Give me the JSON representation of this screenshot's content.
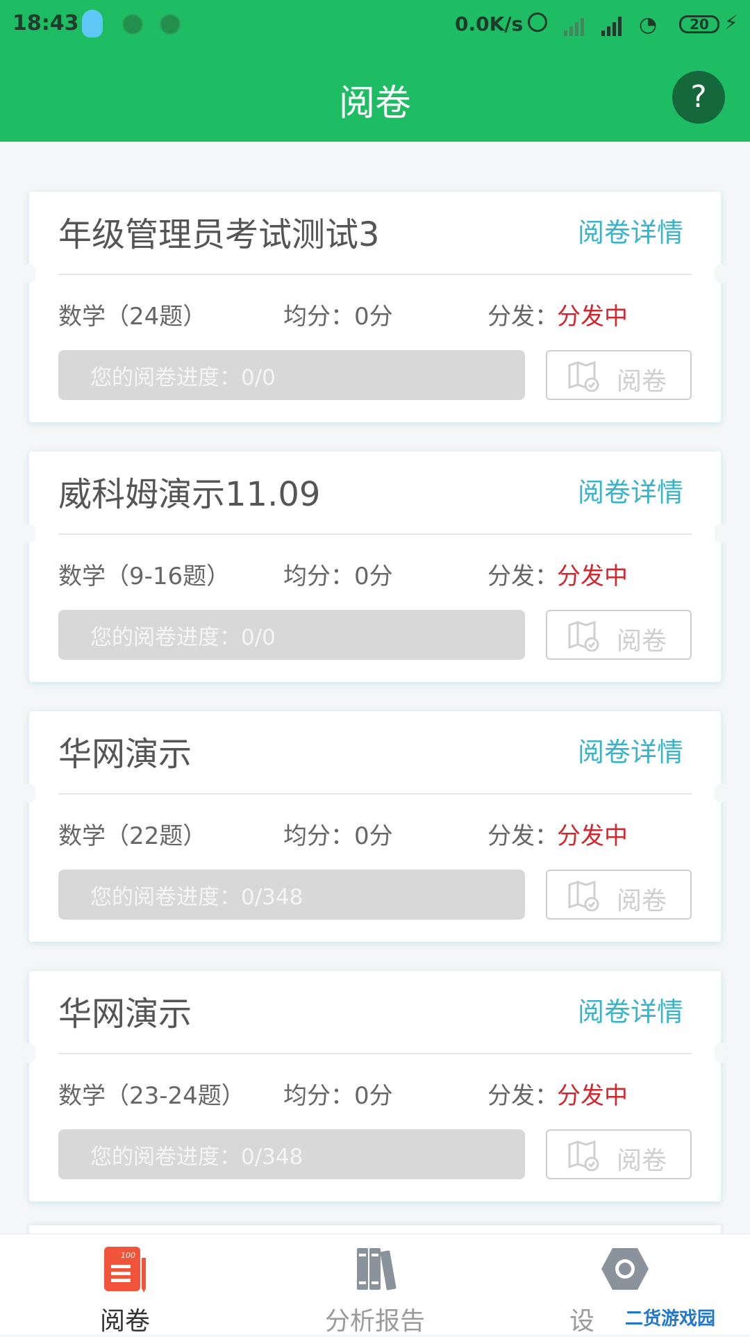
{
  "status_bar": {
    "time": "18:43",
    "net_speed": "0.0K/s",
    "battery": "20"
  },
  "app_bar": {
    "title": "阅卷",
    "help_label": "?"
  },
  "cards": [
    {
      "title": "年级管理员考试测试3",
      "detail_link": "阅卷详情",
      "subject": "数学（24题）",
      "average": "均分：0分",
      "distribution_label": "分发：",
      "distribution_status": "分发中",
      "progress_text": "您的阅卷进度：0/0",
      "progress_fraction": 0,
      "grade_button": "阅卷"
    },
    {
      "title": "威科姆演示11.09",
      "detail_link": "阅卷详情",
      "subject": "数学（9-16题）",
      "average": "均分：0分",
      "distribution_label": "分发：",
      "distribution_status": "分发中",
      "progress_text": "您的阅卷进度：0/0",
      "progress_fraction": 0,
      "grade_button": "阅卷"
    },
    {
      "title": "华网演示",
      "detail_link": "阅卷详情",
      "subject": "数学（22题）",
      "average": "均分：0分",
      "distribution_label": "分发：",
      "distribution_status": "分发中",
      "progress_text": "您的阅卷进度：0/348",
      "progress_fraction": 0,
      "grade_button": "阅卷"
    },
    {
      "title": "华网演示",
      "detail_link": "阅卷详情",
      "subject": "数学（23-24题）",
      "average": "均分：0分",
      "distribution_label": "分发：",
      "distribution_status": "分发中",
      "progress_text": "您的阅卷进度：0/348",
      "progress_fraction": 0,
      "grade_button": "阅卷"
    }
  ],
  "bottom_nav": {
    "items": [
      {
        "label": "阅卷",
        "icon": "grading-paper-icon",
        "active": true
      },
      {
        "label": "分析报告",
        "icon": "books-report-icon",
        "active": false
      },
      {
        "label": "设",
        "icon": "settings-hexagon-icon",
        "active": false
      }
    ]
  },
  "watermark": "二货游戏园",
  "colors": {
    "primary_green": "#1ebd64",
    "link_cyan": "#3ab3c7",
    "status_red": "#d0282e",
    "progress_grey": "#d8d8d8"
  }
}
